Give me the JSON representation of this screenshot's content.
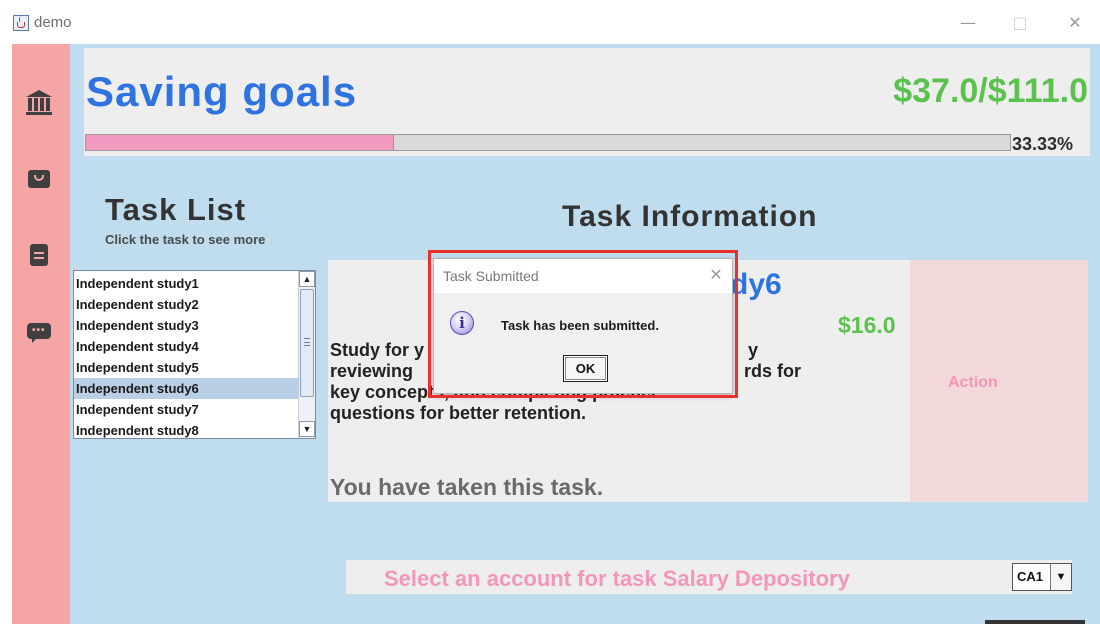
{
  "window": {
    "title": "demo"
  },
  "goals": {
    "title": "Saving goals",
    "amount": "$37.0/$111.0",
    "progress_fraction": 0.3333,
    "progress_text": "33.33%"
  },
  "task_list": {
    "title": "Task List",
    "hint": "Click the task to see more",
    "items": [
      "Independent study1",
      "Independent study2",
      "Independent study3",
      "Independent study4",
      "Independent study5",
      "Independent study6",
      "Independent study7",
      "Independent study8"
    ],
    "selected_index": 5
  },
  "task_info": {
    "title": "Task Information",
    "name_visible": "dy6",
    "price": "$16.0",
    "description_lines": [
      "Study for y",
      "reviewing",
      "key concepts, and completing practice",
      "questions for better retention."
    ],
    "description_fragments": [
      "y",
      "rds for"
    ],
    "status": "You have taken this task.",
    "action_label": "Action"
  },
  "account": {
    "label": "Select an account for task Salary Depository",
    "selected": "CA1"
  },
  "dialog": {
    "title": "Task Submitted",
    "message": "Task has been submitted.",
    "ok_label": "OK",
    "icon_glyph": "i"
  },
  "icons": {
    "sidebar": [
      "bank-icon",
      "shopping-bag-icon",
      "clipboard-icon",
      "chat-icon"
    ],
    "dialog": "info-icon"
  },
  "colors": {
    "sidebar": "#f4a5a4",
    "background": "#bfddef",
    "title_blue": "#2f73e0",
    "amount_green": "#5bc24e",
    "accent_pink": "#f296ba",
    "progress_fill": "#f39ac0",
    "highlight_red": "#e8312b"
  }
}
